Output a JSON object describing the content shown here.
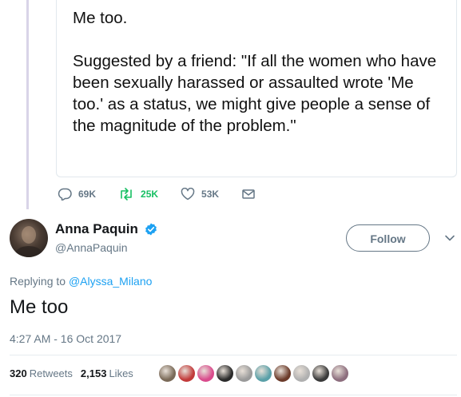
{
  "quoted_tweet": {
    "text": "Me too.\n\nSuggested by a friend: \"If all the women who have been sexually harassed or assaulted wrote 'Me too.' as a status, we might give people a sense of the magnitude of the problem.\""
  },
  "quoted_actions": {
    "replies": "69K",
    "retweets": "25K",
    "likes": "53K"
  },
  "author": {
    "name": "Anna Paquin",
    "handle": "@AnnaPaquin",
    "verified": true
  },
  "follow_label": "Follow",
  "replying_to": {
    "prefix": "Replying to",
    "mention": "@Alyssa_Milano"
  },
  "tweet": {
    "text": "Me too",
    "timestamp": "4:27 AM - 16 Oct 2017"
  },
  "stats": {
    "retweets_count": "320",
    "retweets_label": "Retweets",
    "likes_count": "2,153",
    "likes_label": "Likes"
  },
  "likers": [
    {
      "color": "#7a6a58"
    },
    {
      "color": "#c23a3a"
    },
    {
      "color": "#d94b8c"
    },
    {
      "color": "#2a2a2a"
    },
    {
      "color": "#9a9a9a"
    },
    {
      "color": "#5aa0a8"
    },
    {
      "color": "#6b3b2a"
    },
    {
      "color": "#b0b0b0"
    },
    {
      "color": "#3a3a3a"
    },
    {
      "color": "#8d6e7e"
    }
  ],
  "colors": {
    "accent": "#1da1f2",
    "retweet": "#17bf63",
    "muted": "#657786"
  }
}
